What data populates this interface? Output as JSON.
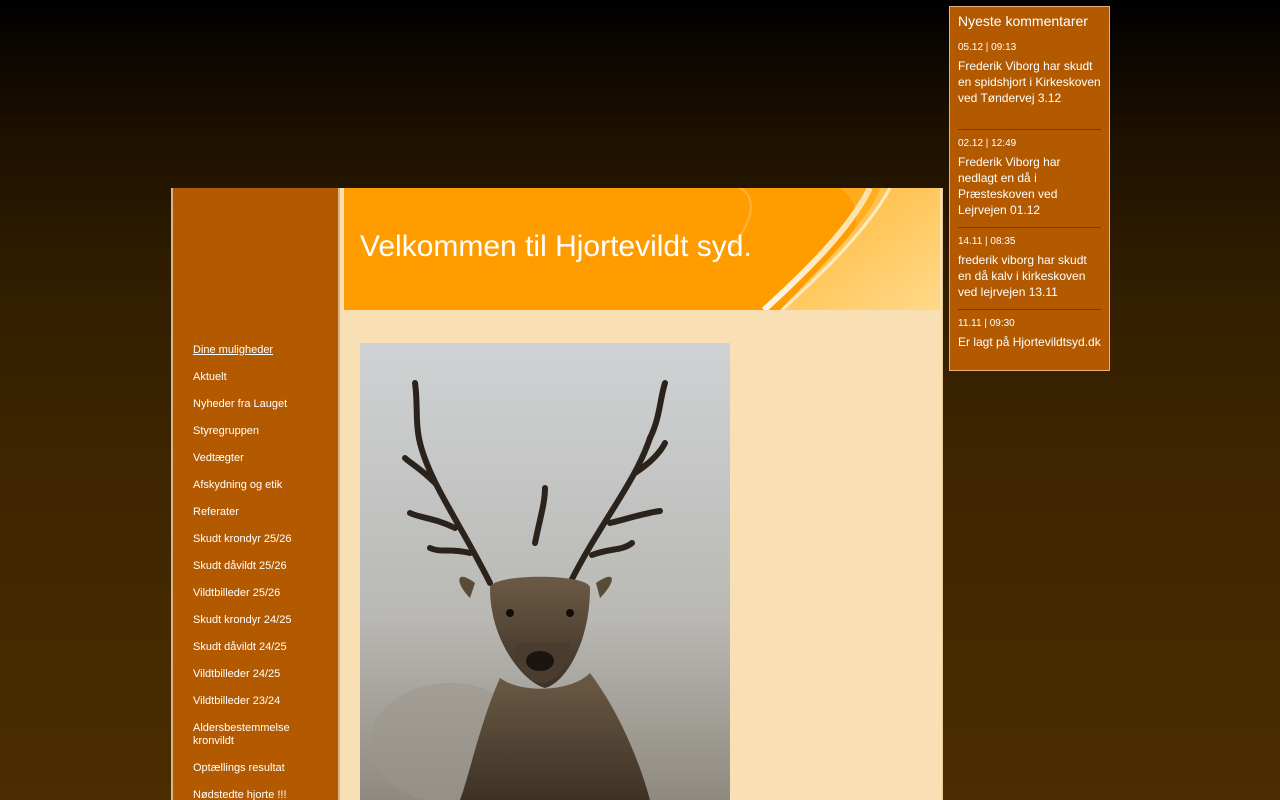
{
  "header": {
    "title": "Velkommen til Hjortevildt syd."
  },
  "sidebar": {
    "items": [
      {
        "label": "Dine muligheder",
        "active": true
      },
      {
        "label": "Aktuelt"
      },
      {
        "label": "Nyheder fra Lauget"
      },
      {
        "label": "Styregruppen"
      },
      {
        "label": "Vedtægter"
      },
      {
        "label": "Afskydning og etik"
      },
      {
        "label": "Referater"
      },
      {
        "label": "Skudt krondyr 25/26"
      },
      {
        "label": "Skudt dåvildt 25/26"
      },
      {
        "label": "Vildtbilleder 25/26"
      },
      {
        "label": "Skudt krondyr 24/25"
      },
      {
        "label": "Skudt dåvildt 24/25"
      },
      {
        "label": "Vildtbilleder 24/25"
      },
      {
        "label": "Vildtbilleder 23/24"
      },
      {
        "label": "Aldersbestemmelse kronvildt"
      },
      {
        "label": "Optællings resultat"
      },
      {
        "label": "Nødstedte hjorte !!!"
      }
    ]
  },
  "comments": {
    "title": "Nyeste kommentarer",
    "items": [
      {
        "date": "05.12 | 09:13",
        "text": "Frederik Viborg har skudt en spidshjort i Kirkeskoven ved Tøndervej 3.12"
      },
      {
        "date": "02.12 | 12:49",
        "text": "Frederik Viborg har nedlagt en då i Præsteskoven ved Lejrvejen 01.12"
      },
      {
        "date": "14.11 | 08:35",
        "text": "frederik viborg har skudt en då kalv i kirkeskoven ved lejrvejen 13.11"
      },
      {
        "date": "11.11 | 09:30",
        "text": "Er lagt på Hjortevildtsyd.dk"
      }
    ]
  },
  "colors": {
    "background": "#2f1c00",
    "sidebar": "#b35a00",
    "banner": "#ff9c00",
    "content": "#f9e0b4"
  }
}
